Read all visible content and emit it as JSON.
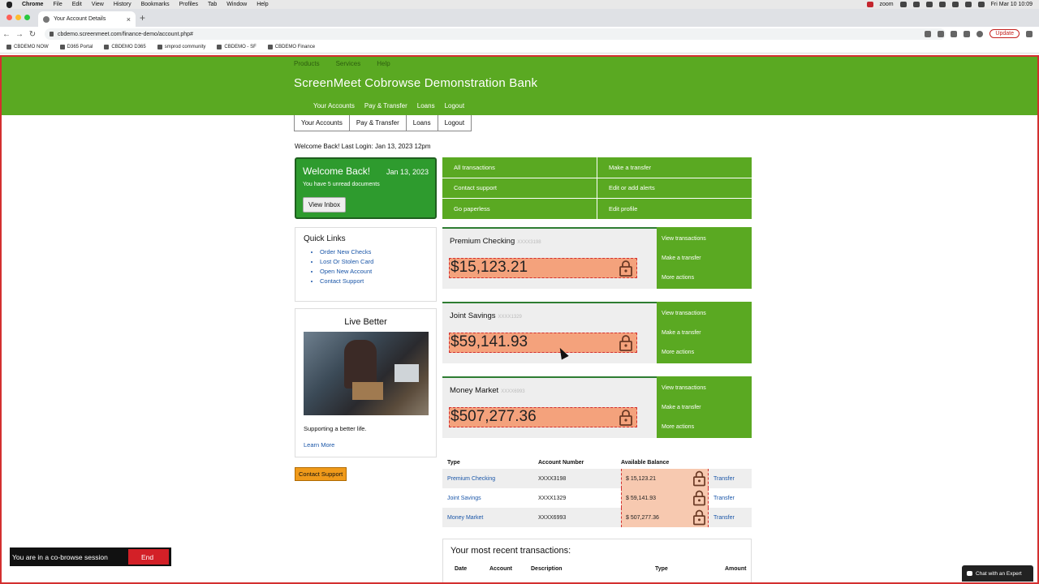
{
  "mac_menu": {
    "app": "Chrome",
    "items": [
      "File",
      "Edit",
      "View",
      "History",
      "Bookmarks",
      "Profiles",
      "Tab",
      "Window",
      "Help"
    ],
    "zoom_label": "zoom",
    "clock": "Fri Mar 10  10:09"
  },
  "browser": {
    "tab_title": "Your Account Details",
    "url": "cbdemo.screenmeet.com/finance-demo/account.php#",
    "update_label": "Update",
    "bookmarks": [
      "CBDEMO NOW",
      "D365 Portal",
      "CBDEMO D365",
      "smprod community",
      "CBDEMO - SF",
      "CBDEMO Finance"
    ]
  },
  "bank": {
    "top_nav": [
      "Products",
      "Services",
      "Help"
    ],
    "title": "ScreenMeet Cobrowse Demonstration Bank",
    "sub_nav": [
      "Your Accounts",
      "Pay & Transfer",
      "Loans",
      "Logout"
    ],
    "tabs": [
      "Your Accounts",
      "Pay & Transfer",
      "Loans",
      "Logout"
    ],
    "welcome_line": "Welcome Back! Last Login: Jan 13, 2023 12pm"
  },
  "welcome_box": {
    "title": "Welcome Back!",
    "date": "Jan 13, 2023",
    "message": "You have 5 unread documents",
    "button": "View Inbox"
  },
  "quick_grid": [
    "All transactions",
    "Make a transfer",
    "Contact support",
    "Edit or add alerts",
    "Go paperless",
    "Edit profile"
  ],
  "quick_links": {
    "title": "Quick Links",
    "items": [
      "Order New Checks",
      "Lost Or Stolen Card",
      "Open New Account",
      "Contact Support"
    ]
  },
  "live_better": {
    "title": "Live Better",
    "caption": "Supporting a better life.",
    "link": "Learn More"
  },
  "contact_button": "Contact Support",
  "accounts": [
    {
      "name": "Premium Checking",
      "mask": "XXXX3198",
      "balance": "$15,123.21",
      "actions": [
        "View transactions",
        "Make a transfer",
        "More actions"
      ]
    },
    {
      "name": "Joint Savings",
      "mask": "XXXX1329",
      "balance": "$59,141.93",
      "actions": [
        "View transactions",
        "Make a transfer",
        "More actions"
      ]
    },
    {
      "name": "Money Market",
      "mask": "XXXX6993",
      "balance": "$507,277.36",
      "actions": [
        "View transactions",
        "Make a transfer",
        "More actions"
      ]
    }
  ],
  "account_table": {
    "headers": [
      "Type",
      "Account Number",
      "Available Balance"
    ],
    "rows": [
      {
        "type": "Premium Checking",
        "number": "XXXX3198",
        "balance": "$ 15,123.21",
        "action": "Transfer"
      },
      {
        "type": "Joint Savings",
        "number": "XXXX1329",
        "balance": "$ 59,141.93",
        "action": "Transfer"
      },
      {
        "type": "Money Market",
        "number": "XXXX6993",
        "balance": "$ 507,277.36",
        "action": "Transfer"
      }
    ]
  },
  "recent": {
    "title": "Your most recent transactions:",
    "headers": [
      "Date",
      "Account",
      "Description",
      "Type",
      "Amount"
    ]
  },
  "cobrowse": {
    "message": "You are in a co-browse session",
    "end_label": "End"
  },
  "chat": {
    "label": "Chat with an Expert"
  },
  "colors": {
    "bank_green": "#5aa922",
    "welcome_green": "#2e9b2e",
    "masked_orange": "#f4a27c",
    "mask_border": "#d32f2f",
    "contact_orange": "#f09a1a"
  }
}
